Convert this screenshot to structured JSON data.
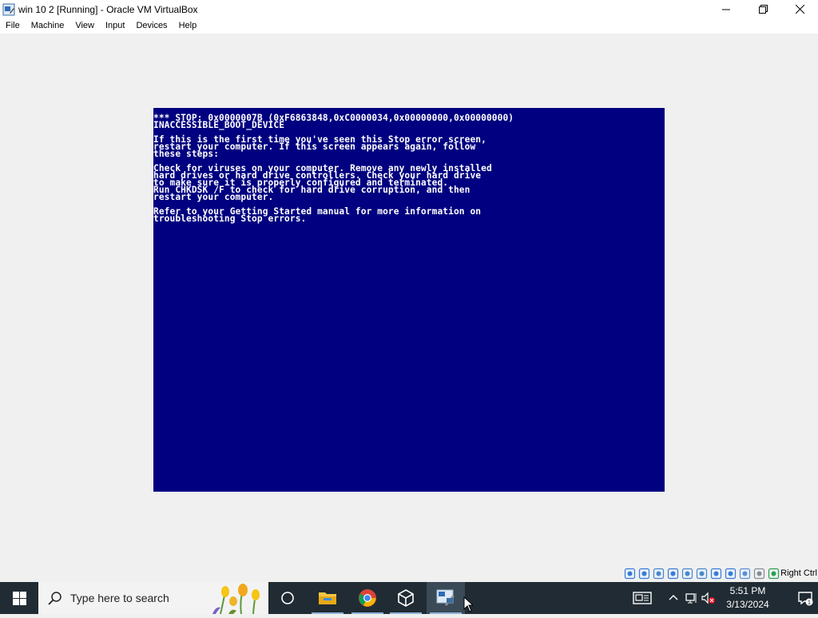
{
  "window": {
    "title": "win 10 2 [Running] - Oracle VM VirtualBox"
  },
  "menu": {
    "items": [
      "File",
      "Machine",
      "View",
      "Input",
      "Devices",
      "Help"
    ]
  },
  "bsod": {
    "lines": [
      "*** STOP: 0x0000007B (0xF6863848,0xC0000034,0x00000000,0x00000000)",
      "INACCESSIBLE_BOOT_DEVICE",
      "",
      "If this is the first time you've seen this Stop error screen,",
      "restart your computer. If this screen appears again, follow",
      "these steps:",
      "",
      "Check for viruses on your computer. Remove any newly installed",
      "hard drives or hard drive controllers. Check your hard drive",
      "to make sure it is properly configured and terminated.",
      "Run CHKDSK /F to check for hard drive corruption, and then",
      "restart your computer.",
      "",
      "Refer to your Getting Started manual for more information on",
      "troubleshooting Stop errors."
    ],
    "colors": {
      "background": "#000080",
      "text": "#ffffff"
    }
  },
  "statusbar": {
    "host_key": "Right Ctrl",
    "icons": [
      "hard-disk-icon",
      "optical-drive-icon",
      "audio-icon",
      "network-icon",
      "usb-icon",
      "shared-folders-icon",
      "display-icon",
      "recording-icon",
      "virtualization-icon",
      "mouse-integration-icon",
      "keyboard-icon"
    ]
  },
  "taskbar": {
    "search_placeholder": "Type here to search",
    "apps": [
      "task-view-icon",
      "file-explorer-icon",
      "chrome-icon",
      "virtualbox-icon",
      "vm-window-icon"
    ],
    "clock_time": "5:51 PM",
    "clock_date": "3/13/2024"
  }
}
